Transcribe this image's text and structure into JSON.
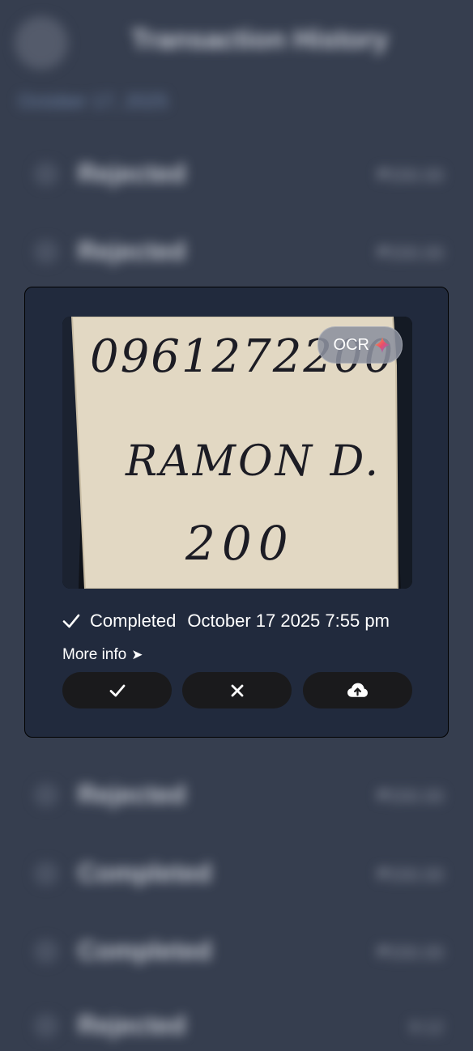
{
  "background": {
    "title": "Transaction History",
    "subtitle": "October 17, 2025",
    "rows": [
      {
        "label": "Rejected",
        "amount": "₱200.00"
      },
      {
        "label": "Rejected",
        "amount": "₱200.00"
      },
      {
        "label": "Rejected",
        "amount": "₱200.00"
      },
      {
        "label": "Completed",
        "amount": "₱200.00"
      },
      {
        "label": "Completed",
        "amount": "₱200.00"
      },
      {
        "label": "Rejected",
        "amount": "9:12"
      }
    ]
  },
  "card": {
    "photo": {
      "icon": "receipt-photo",
      "handwriting": {
        "line1": "0961272200",
        "line2": "RAMON D.",
        "line3": "200"
      }
    },
    "ocr_badge": {
      "label": "OCR",
      "icon": "sparkle-icon"
    },
    "status": {
      "label": "Completed",
      "timestamp": "October 17 2025 7:55 pm",
      "icon": "checkmark-icon"
    },
    "more_info": {
      "label": "More info",
      "arrow": "➤"
    },
    "actions": [
      {
        "icon": "check-icon"
      },
      {
        "icon": "close-icon"
      },
      {
        "icon": "cloud-upload-icon"
      }
    ]
  },
  "colors": {
    "background": "#363e4f",
    "card": "#212a3d",
    "button": "#1a1a1c",
    "paper": "#e2d8c3"
  }
}
